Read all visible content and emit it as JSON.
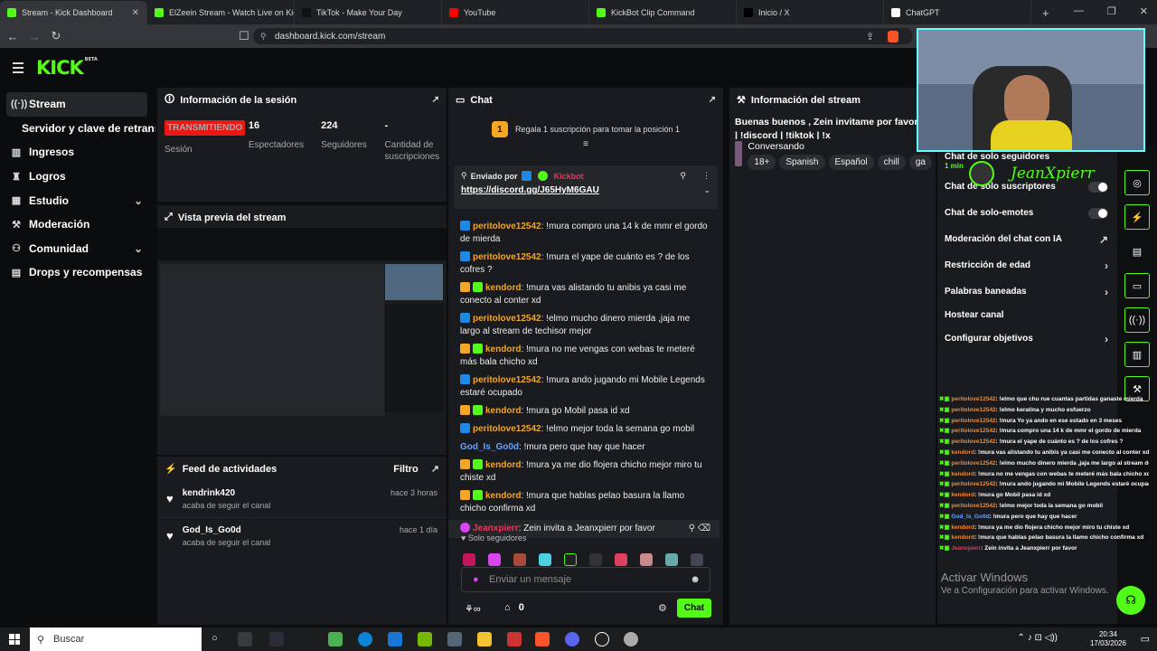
{
  "browser": {
    "tabs": [
      {
        "label": "Stream - Kick Dashboard",
        "color": "#53fc18"
      },
      {
        "label": "ElZeein Stream - Watch Live on Kick",
        "color": "#53fc18"
      },
      {
        "label": "TikTok - Make Your Day",
        "color": "#111111"
      },
      {
        "label": "YouTube",
        "color": "#ff0000"
      },
      {
        "label": "KickBot Clip Command",
        "color": "#53fc18"
      },
      {
        "label": "Inicio / X",
        "color": "#000000"
      },
      {
        "label": "ChatGPT",
        "color": "#ffffff"
      }
    ],
    "url": "dashboard.kick.com/stream"
  },
  "brand": {
    "logo": "KICK",
    "beta": "BETA",
    "accent": "#53fc18"
  },
  "sidebar": {
    "items": [
      {
        "label": "Stream",
        "icon": "stream-icon"
      },
      {
        "label": "Servidor y clave de retransmisión"
      },
      {
        "label": "Ingresos",
        "icon": "chart-icon"
      },
      {
        "label": "Logros",
        "icon": "trophy-icon"
      },
      {
        "label": "Estudio",
        "icon": "studio-icon"
      },
      {
        "label": "Moderación",
        "icon": "wrench-icon"
      },
      {
        "label": "Comunidad",
        "icon": "people-icon"
      },
      {
        "label": "Drops y recompensas",
        "icon": "gift-icon"
      }
    ]
  },
  "session": {
    "title": "Información de la sesión",
    "status": "TRANSMITIENDO",
    "status_label": "Sesión",
    "viewers": "16",
    "viewers_label": "Espectadores",
    "followers": "224",
    "followers_label": "Seguidores",
    "subs": "-",
    "subs_label": "Cantidad de suscripciones"
  },
  "preview": {
    "title": "Vista previa del stream"
  },
  "feed": {
    "title": "Feed de actividades",
    "filter": "Filtro",
    "items": [
      {
        "user": "kendrink420",
        "action": "acaba de seguir el canal",
        "time": "hace 3 horas"
      },
      {
        "user": "God_Is_Go0d",
        "action": "acaba de seguir el canal",
        "time": "hace 1 día"
      }
    ]
  },
  "chat": {
    "title": "Chat",
    "gift_prompt": "Regala 1 suscripción para tomar la posición 1",
    "gift_rank": "1",
    "pinned_by_label": "Enviado por",
    "pinned_user": "Kickbot",
    "pinned_link": "https://discord.gg/J65HyM6GAU",
    "messages": [
      {
        "user": "peritolove12542",
        "color": "#f5a623",
        "text": ": !mura compro una 14 k de mmr el gordo de mierda"
      },
      {
        "user": "peritolove12542",
        "color": "#f5a623",
        "text": ": !mura el yape de cuánto es ? de los cofres ?"
      },
      {
        "user": "kendord",
        "color": "#f5a623",
        "text": ": !mura vas alistando tu anibis ya casi me conecto al conter xd"
      },
      {
        "user": "peritolove12542",
        "color": "#f5a623",
        "text": ": !elmo mucho dinero mierda ,jaja me largo al stream de techisor mejor"
      },
      {
        "user": "kendord",
        "color": "#f5a623",
        "text": ": !mura no me vengas con webas te meteré más bala chicho xd"
      },
      {
        "user": "peritolove12542",
        "color": "#f5a623",
        "text": ": !mura ando jugando mi Mobile Legends estaré ocupado"
      },
      {
        "user": "kendord",
        "color": "#f5a623",
        "text": ": !mura go Mobil pasa id xd"
      },
      {
        "user": "peritolove12542",
        "color": "#f5a623",
        "text": ": !elmo mejor toda la semana go mobil"
      },
      {
        "user": "God_Is_Go0d",
        "color": "#66a3ff",
        "text": ": !mura pero que hay que hacer"
      },
      {
        "user": "kendord",
        "color": "#f5a623",
        "text": ": !mura ya me dio flojera chicho mejor miro tu chiste xd"
      },
      {
        "user": "kendord",
        "color": "#f5a623",
        "text": ": !mura que hablas pelao basura la llamo chicho confirma xd"
      },
      {
        "user": "Jeanxpierr",
        "color": "#e9385a",
        "text": ": Zein invita a Jeanxpierr por favor"
      }
    ],
    "followers_only": "Solo seguidores",
    "input_placeholder": "Enviar un mensaje",
    "points": "0",
    "send_label": "Chat"
  },
  "stream_info": {
    "title": "Información del stream",
    "stream_title": "Buenas buenos , Zein invitame por favor;3 | !discord | !tiktok | !x",
    "category": "Conversando",
    "tags": [
      "18+",
      "Spanish",
      "Español",
      "chill",
      "ga"
    ]
  },
  "chat_settings": {
    "partial_label": "Chat de solo seguidores",
    "partial_value": "1 min",
    "rows": [
      {
        "label": "Chat de solo suscriptores",
        "type": "toggle"
      },
      {
        "label": "Chat de solo-emotes",
        "type": "toggle"
      },
      {
        "label": "Moderación del chat con IA",
        "type": "link"
      },
      {
        "label": "Restricción de edad",
        "type": "chevron"
      },
      {
        "label": "Palabras baneadas",
        "type": "chevron"
      },
      {
        "label": "Hostear canal",
        "type": "none"
      },
      {
        "label": "Configurar objetivos",
        "type": "chevron"
      }
    ]
  },
  "overlay_chat": [
    {
      "user": "peritolove12542",
      "text": ": !elmo que chu rue cuantas partidas ganaste mierda"
    },
    {
      "user": "peritolove12542",
      "text": ": !elmo keratina y mucho esfuerzo"
    },
    {
      "user": "peritolove12542",
      "text": ": !mura Yo ya ando en ese estado en 3 meses"
    },
    {
      "user": "peritolove12542",
      "text": ": !mura compro una 14 k de mmr el gordo de mierda"
    },
    {
      "user": "peritolove12542",
      "text": ": !mura el yape de cuánto es ? de los cofres ?"
    },
    {
      "user": "kendord",
      "text": ": !mura vas alistando tu anibis ya casi me conecto al conter xd"
    },
    {
      "user": "peritolove12542",
      "text": ": !elmo mucho dinero mierda ,jaja me largo al stream de techisor mejor"
    },
    {
      "user": "kendord",
      "text": ": !mura no me vengas con webas te meteré más bala chicho xd"
    },
    {
      "user": "peritolove12542",
      "text": ": !mura ando jugando mi Mobile Legends estaré ocupado"
    },
    {
      "user": "kendord",
      "text": ": !mura go Mobil pasa id xd"
    },
    {
      "user": "peritolove12542",
      "text": ": !elmo mejor toda la semana go mobil"
    },
    {
      "user": "God_Is_Go0d",
      "text": ": !mura pero que hay que hacer"
    },
    {
      "user": "kendord",
      "text": ": !mura ya me dio flojera chicho mejor miro tu chiste xd"
    },
    {
      "user": "kendord",
      "text": ": !mura que hablas pelao basura la llamo chicho confirma xd"
    },
    {
      "user": "Jeanxpierr",
      "text": ": Zein invita a Jeanxpierr por favor"
    }
  ],
  "webcam": {
    "name": "JeanXpierr"
  },
  "windows": {
    "activate_title": "Activar Windows",
    "activate_sub": "Ve a Configuración para activar Windows.",
    "search": "Buscar",
    "time": "20:34",
    "date": "17/03/2026"
  }
}
